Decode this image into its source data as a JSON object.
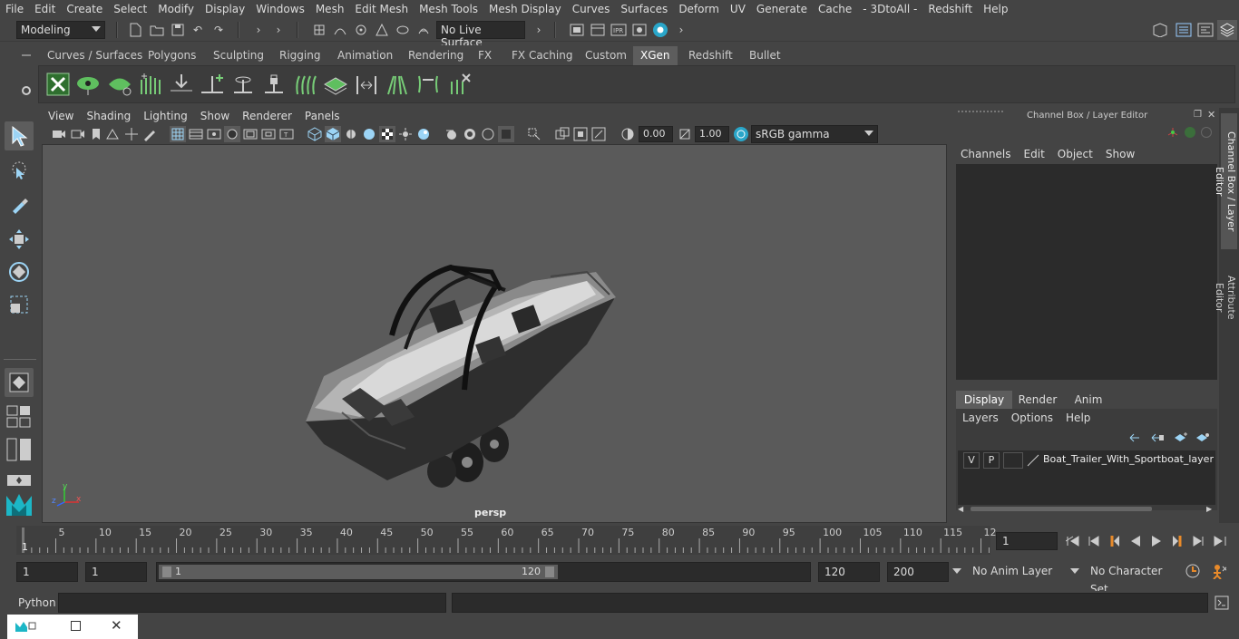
{
  "menubar": {
    "items": [
      "File",
      "Edit",
      "Create",
      "Select",
      "Modify",
      "Display",
      "Windows",
      "Mesh",
      "Edit Mesh",
      "Mesh Tools",
      "Mesh Display",
      "Curves",
      "Surfaces",
      "Deform",
      "UV",
      "Generate",
      "Cache",
      "- 3DtoAll -",
      "Redshift",
      "Help"
    ]
  },
  "status": {
    "mode": "Modeling",
    "live_surface": "No Live Surface"
  },
  "shelf": {
    "tabs": [
      "Curves / Surfaces",
      "Polygons",
      "Sculpting",
      "Rigging",
      "Animation",
      "Rendering",
      "FX",
      "FX Caching",
      "Custom",
      "XGen",
      "Redshift",
      "Bullet"
    ],
    "active_tab": "XGen"
  },
  "viewport": {
    "menu": [
      "View",
      "Shading",
      "Lighting",
      "Show",
      "Renderer",
      "Panels"
    ],
    "exposure": "0.00",
    "gamma": "1.00",
    "color_space": "sRGB gamma",
    "camera_label": "persp",
    "axis": {
      "x": "x",
      "y": "y",
      "z": "z"
    }
  },
  "channel_box": {
    "title": "Channel Box / Layer Editor",
    "menu": [
      "Channels",
      "Edit",
      "Object",
      "Show"
    ],
    "layer_tabs": [
      "Display",
      "Render",
      "Anim"
    ],
    "active_layer_tab": "Display",
    "layer_menu": [
      "Layers",
      "Options",
      "Help"
    ],
    "layer": {
      "v": "V",
      "p": "P",
      "name": "Boat_Trailer_With_Sportboat_layer"
    }
  },
  "side_tabs": [
    "Channel Box / Layer Editor",
    "Attribute Editor"
  ],
  "timeline": {
    "ticks": [
      "5",
      "10",
      "15",
      "20",
      "25",
      "30",
      "35",
      "40",
      "45",
      "50",
      "55",
      "60",
      "65",
      "70",
      "75",
      "80",
      "85",
      "90",
      "95",
      "100",
      "105",
      "110",
      "115",
      "12"
    ],
    "start_tick": "1",
    "current_frame": "1"
  },
  "range": {
    "start": "1",
    "playback_start": "1",
    "slider_start": "1",
    "slider_end": "120",
    "playback_end": "120",
    "end": "200",
    "anim_layer": "No Anim Layer",
    "character_set": "No Character Set"
  },
  "cmdline": {
    "label": "Python"
  }
}
